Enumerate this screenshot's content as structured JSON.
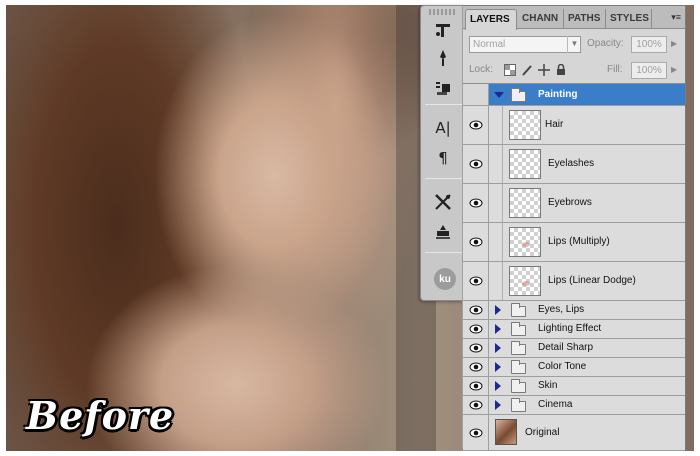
{
  "image": {
    "caption": "Before"
  },
  "tools": [
    {
      "icon": "tool-presets-icon"
    },
    {
      "icon": "brush-icon"
    },
    {
      "icon": "clone-source-icon"
    },
    {
      "icon": "character-icon",
      "glyph": "A|"
    },
    {
      "icon": "paragraph-icon",
      "glyph": "¶"
    },
    {
      "icon": "tool-options-icon"
    },
    {
      "icon": "stamp-icon"
    },
    {
      "icon": "ku-badge-icon",
      "glyph": "ku"
    }
  ],
  "panel": {
    "tabs": [
      {
        "label": "LAYERS",
        "active": true
      },
      {
        "label": "CHANN",
        "active": false
      },
      {
        "label": "PATHS",
        "active": false
      },
      {
        "label": "STYLES",
        "active": false
      }
    ],
    "menu_glyph": "▾≡",
    "blend_mode": "Normal",
    "opacity_label": "Opacity:",
    "opacity_value": "100%",
    "lock_label": "Lock:",
    "fill_label": "Fill:",
    "fill_value": "100%",
    "layers": [
      {
        "name": "Painting",
        "type": "group",
        "expanded": true,
        "selected": true,
        "visible": false
      },
      {
        "name": "Hair",
        "type": "layer",
        "visible": true,
        "indent": true
      },
      {
        "name": "Eyelashes",
        "type": "layer",
        "visible": true,
        "indent": true
      },
      {
        "name": "Eyebrows",
        "type": "layer",
        "visible": true,
        "indent": true
      },
      {
        "name": "Lips (Multiply)",
        "type": "layer",
        "visible": true,
        "indent": true
      },
      {
        "name": "Lips (Linear Dodge)",
        "type": "layer",
        "visible": true,
        "indent": true
      },
      {
        "name": "Eyes, Lips",
        "type": "group",
        "visible": true
      },
      {
        "name": "Lighting Effect",
        "type": "group",
        "visible": true
      },
      {
        "name": "Detail Sharp",
        "type": "group",
        "visible": true
      },
      {
        "name": "Color Tone",
        "type": "group",
        "visible": true
      },
      {
        "name": "Skin",
        "type": "group",
        "visible": true
      },
      {
        "name": "Cinema",
        "type": "group",
        "visible": true
      },
      {
        "name": "Original",
        "type": "image",
        "visible": true
      }
    ]
  },
  "colors": {
    "selection": "#3a7ec9",
    "panel_bg": "#d6d6d6",
    "triangle": "#1d2b8a"
  }
}
